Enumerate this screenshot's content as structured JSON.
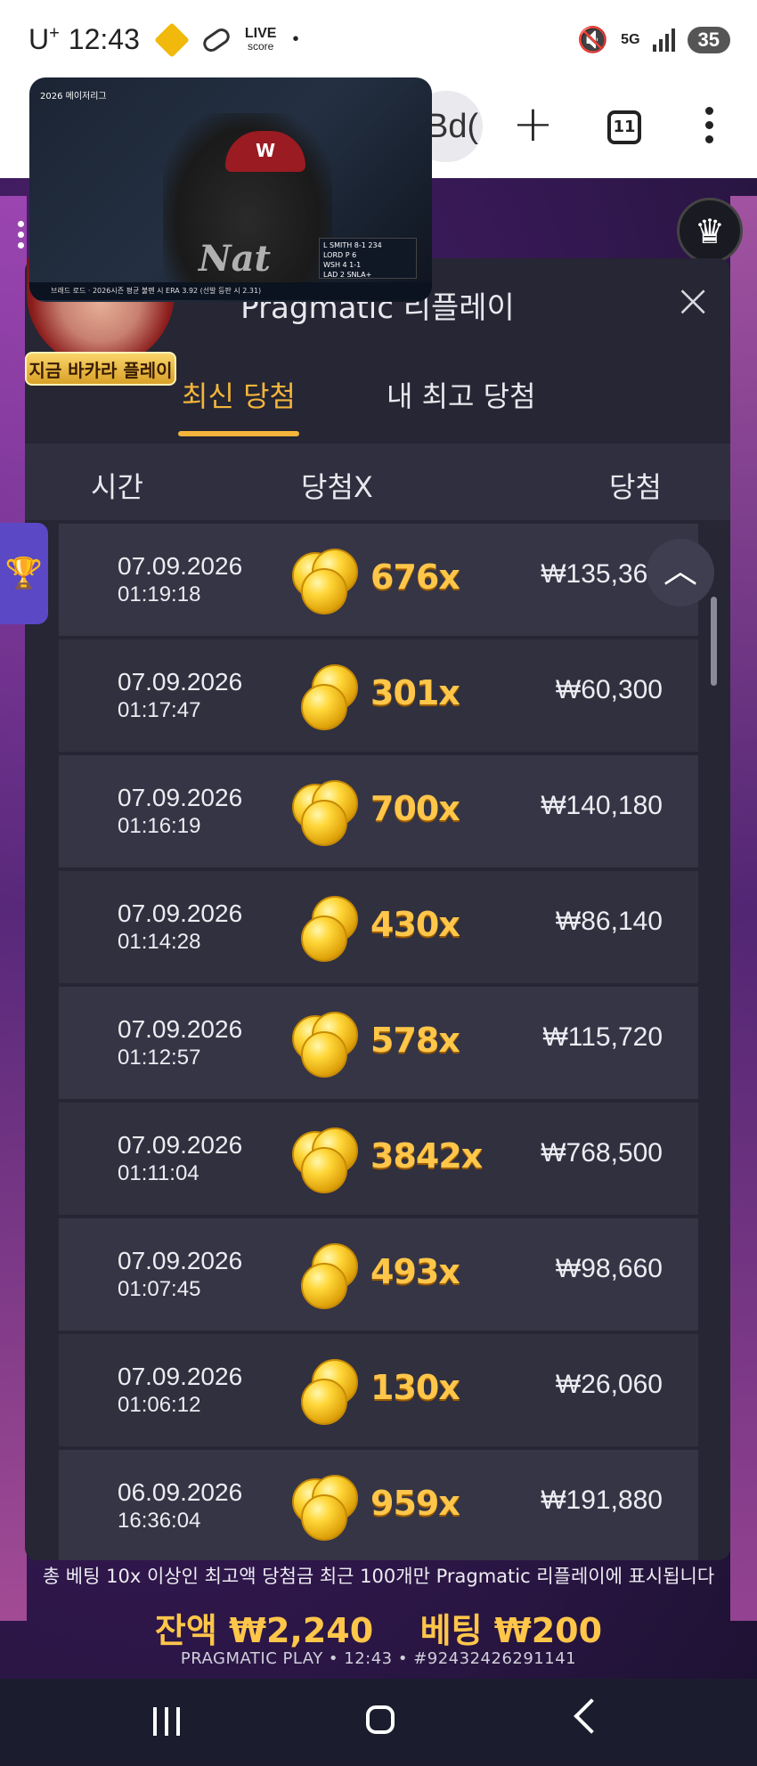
{
  "status_bar": {
    "carrier": "U",
    "carrier_plus": "+",
    "time": "12:43",
    "live_label": "LIVE",
    "live_sub": "score",
    "network": "5G",
    "battery": "35"
  },
  "browser": {
    "url_fragment": "Bd(",
    "tab_count": "11"
  },
  "video": {
    "top_title": "2026 메이저리그",
    "jersey_text": "Nat",
    "cap_letter": "W",
    "score_lines": [
      "L SMITH  8-1  234",
      "LORD  P 6",
      "WSH 4  1-1",
      "LAD 2  SNLA+"
    ],
    "ticker": "브래드 로드 · 2026시즌 평균 불펜 시 ERA 3.92 (선발 등판 시 2.31)"
  },
  "avatar": {
    "badge": "지금 바카라 플레이"
  },
  "popup": {
    "title": "Pragmatic 리플레이",
    "close_icon": "×",
    "tabs": [
      {
        "label": "최신 당첨",
        "active": true
      },
      {
        "label": "내 최고 당첨",
        "active": false
      }
    ],
    "columns": {
      "time": "시간",
      "multiplier": "당첨X",
      "win": "당첨"
    },
    "rows": [
      {
        "date": "07.09.2026",
        "time": "01:19:18",
        "multiplier": "676x",
        "win": "₩135,360"
      },
      {
        "date": "07.09.2026",
        "time": "01:17:47",
        "multiplier": "301x",
        "win": "₩60,300"
      },
      {
        "date": "07.09.2026",
        "time": "01:16:19",
        "multiplier": "700x",
        "win": "₩140,180"
      },
      {
        "date": "07.09.2026",
        "time": "01:14:28",
        "multiplier": "430x",
        "win": "₩86,140"
      },
      {
        "date": "07.09.2026",
        "time": "01:12:57",
        "multiplier": "578x",
        "win": "₩115,720"
      },
      {
        "date": "07.09.2026",
        "time": "01:11:04",
        "multiplier": "3842x",
        "win": "₩768,500"
      },
      {
        "date": "07.09.2026",
        "time": "01:07:45",
        "multiplier": "493x",
        "win": "₩98,660"
      },
      {
        "date": "07.09.2026",
        "time": "01:06:12",
        "multiplier": "130x",
        "win": "₩26,060"
      },
      {
        "date": "06.09.2026",
        "time": "16:36:04",
        "multiplier": "959x",
        "win": "₩191,880"
      }
    ]
  },
  "footer": {
    "note": "총 베팅 10x 이상인 최고액 당첨금 최근 100개만 Pragmatic 리플레이에 표시됩니다",
    "balance_label": "잔액",
    "balance_value": "₩2,240",
    "bet_label": "베팅",
    "bet_value": "₩200",
    "provider_line": "PRAGMATIC PLAY • 12:43 • #92432426291141"
  },
  "colors": {
    "accent_gold": "#f3b53a",
    "panel": "#262634",
    "row": "#353545"
  }
}
